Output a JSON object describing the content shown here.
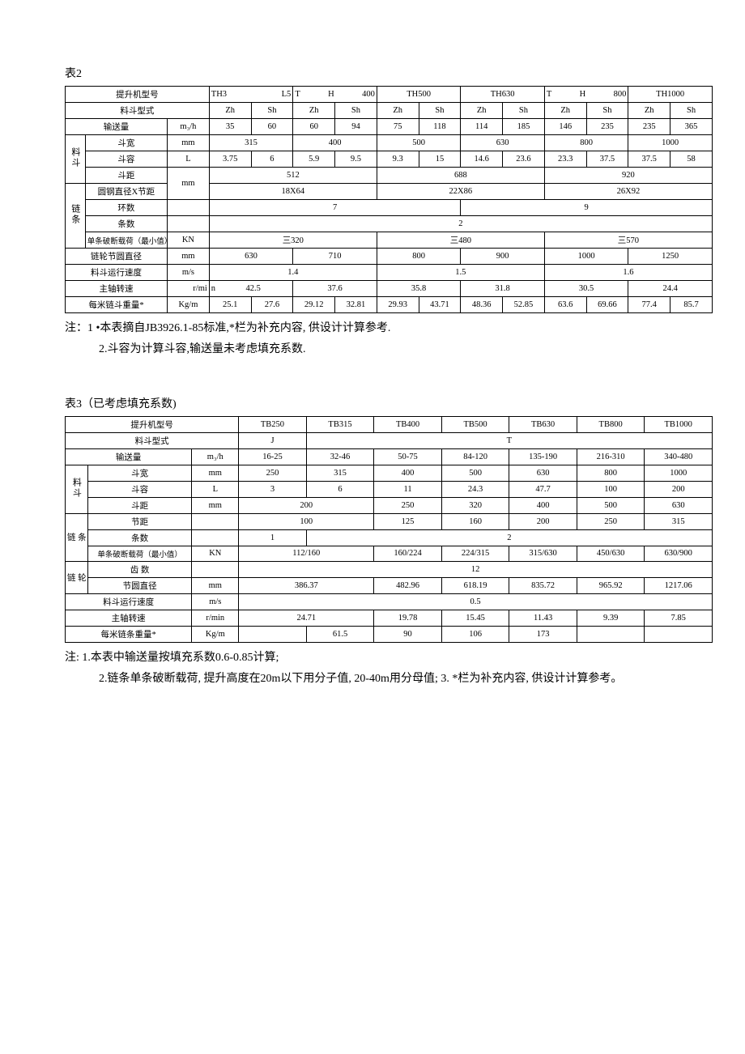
{
  "table2": {
    "title": "表2",
    "headers": {
      "model": "提升机型号",
      "models": [
        "TH3",
        "L5",
        "T",
        "H",
        "400",
        "TH500",
        "TH630",
        "T",
        "H",
        "800",
        "TH1000"
      ],
      "models_display": {
        "c1": "TH3",
        "c2": "L5",
        "c3": "T",
        "c4": "H",
        "c5": "400",
        "c6": "TH500",
        "c7": "TH630",
        "c8": "T",
        "c9": "H",
        "c10": "800",
        "c11": "TH1000"
      },
      "bucket_type": "料斗型式",
      "bucket_types": [
        "Zh",
        "Sh",
        "Zh",
        "Sh",
        "Zh",
        "Sh",
        "Zh",
        "Sh",
        "Zh",
        "Sh",
        "Zh",
        "Sh"
      ],
      "throughput": "输送量",
      "throughput_unit": "m₃/h",
      "throughput_vals": [
        "35",
        "60",
        "60",
        "94",
        "75",
        "118",
        "114",
        "185",
        "146",
        "235",
        "235",
        "365"
      ],
      "bucket_section": "料斗",
      "bucket_width": "斗宽",
      "bucket_width_unit": "mm",
      "bucket_width_vals": [
        "315",
        "400",
        "500",
        "630",
        "800",
        "1000"
      ],
      "bucket_vol": "斗容",
      "bucket_vol_unit": "L",
      "bucket_vol_vals": [
        "3.75",
        "6",
        "5.9",
        "9.5",
        "9.3",
        "15",
        "14.6",
        "23.6",
        "23.3",
        "37.5",
        "37.5",
        "58"
      ],
      "bucket_pitch": "斗距",
      "bucket_pitch_unit": "mm",
      "bucket_pitch_vals": [
        "512",
        "688",
        "920"
      ],
      "chain_section": "链条",
      "round_bar": "圆钢直径X节距",
      "round_bar_vals": [
        "18X64",
        "22X86",
        "26X92"
      ],
      "rings": "环数",
      "rings_vals": [
        "7",
        "9"
      ],
      "strands": "条数",
      "strands_vals": [
        "2"
      ],
      "break_load": "单条破断载荷（最小值）",
      "break_load_unit": "KN",
      "break_load_vals": [
        "三320",
        "三480",
        "三570"
      ],
      "sprocket": "链轮节圆直径",
      "sprocket_unit": "mm",
      "sprocket_vals": [
        "630",
        "710",
        "800",
        "900",
        "1000",
        "1250"
      ],
      "speed": "料斗运行速度",
      "speed_unit": "m/s",
      "speed_vals": [
        "1.4",
        "1.5",
        "1.6"
      ],
      "shaft": "主轴转速",
      "shaft_unit": "r/mi",
      "shaft_unit2": "n",
      "shaft_vals": [
        "42.5",
        "37.6",
        "35.8",
        "31.8",
        "30.5",
        "24.4"
      ],
      "weight": "每米链斗重量*",
      "weight_unit": "Kg/m",
      "weight_vals": [
        "25.1",
        "27.6",
        "29.12",
        "32.81",
        "29.93",
        "43.71",
        "48.36",
        "52.85",
        "63.6",
        "69.66",
        "77.4",
        "85.7"
      ]
    },
    "notes": [
      "注：1 •本表摘自JB3926.1-85标准,*栏为补充内容, 供设计计算参考.",
      "2.斗容为计算斗容,输送量未考虑填充系数."
    ]
  },
  "table3": {
    "title": "表3（已考虑填充系数)",
    "h": {
      "model": "提升机型号",
      "models": [
        "TB250",
        "TB315",
        "TB400",
        "TB500",
        "TB630",
        "TB800",
        "TB1000"
      ],
      "bucket_type": "料斗型式",
      "bucket_types": [
        "J",
        "T"
      ],
      "throughput": "输送量",
      "throughput_unit": "m₃/h",
      "throughput_vals": [
        "16-25",
        "32-46",
        "50-75",
        "84-120",
        "135-190",
        "216-310",
        "340-480"
      ],
      "bucket_section": "料斗",
      "bucket_width": "斗宽",
      "bucket_width_unit": "mm",
      "bucket_width_vals": [
        "250",
        "315",
        "400",
        "500",
        "630",
        "800",
        "1000"
      ],
      "bucket_vol": "斗容",
      "bucket_vol_unit": "L",
      "bucket_vol_vals": [
        "3",
        "6",
        "11",
        "24.3",
        "47.7",
        "100",
        "200"
      ],
      "bucket_pitch": "斗距",
      "bucket_pitch_unit": "mm",
      "bucket_pitch_vals": [
        "200",
        "250",
        "320",
        "400",
        "500",
        "630"
      ],
      "chain_section": "链  条",
      "link_pitch": "节距",
      "link_pitch_vals": [
        "100",
        "125",
        "160",
        "200",
        "250",
        "315"
      ],
      "strands": "条数",
      "strands_vals": [
        "1",
        "2"
      ],
      "break_load": "单条破断载荷（最小值）",
      "break_load_unit": "KN",
      "break_load_vals": [
        "112/160",
        "160/224",
        "224/315",
        "315/630",
        "450/630",
        "630/900"
      ],
      "sprocket_section": "链  轮",
      "teeth": "齿    数",
      "teeth_vals": [
        "12"
      ],
      "pitch_circle": "节圆直径",
      "pitch_circle_unit": "mm",
      "pitch_circle_vals": [
        "386.37",
        "482.96",
        "618.19",
        "835.72",
        "965.92",
        "1217.06"
      ],
      "speed": "料斗运行速度",
      "speed_unit": "m/s",
      "speed_val": "0.5",
      "shaft": "主轴转速",
      "shaft_unit": "r/min",
      "shaft_vals": [
        "24.71",
        "19.78",
        "15.45",
        "11.43",
        "9.39",
        "7.85"
      ],
      "weight": "每米链条重量*",
      "weight_unit": "Kg/m",
      "weight_vals": [
        "",
        "61.5",
        "90",
        "106",
        "173",
        "",
        ""
      ]
    },
    "notes": [
      "注:  1.本表中输送量按填充系数0.6-0.85计算;",
      "2.链条单条破断载荷, 提升高度在20m以下用分子值, 20-40m用分母值; 3. *栏为补充内容, 供设计计算参考。"
    ]
  }
}
